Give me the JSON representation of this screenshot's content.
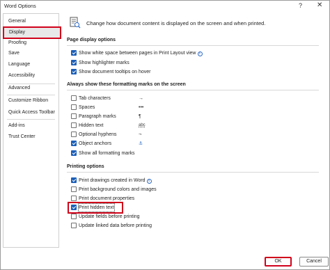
{
  "window": {
    "title": "Word Options",
    "help_glyph": "?",
    "close_glyph": "✕"
  },
  "sidebar": {
    "items": [
      {
        "label": "General"
      },
      {
        "label": "Display"
      },
      {
        "label": "Proofing"
      },
      {
        "label": "Save"
      },
      {
        "label": "Language"
      },
      {
        "label": "Accessibility"
      },
      {
        "label": "Advanced"
      },
      {
        "label": "Customize Ribbon"
      },
      {
        "label": "Quick Access Toolbar"
      },
      {
        "label": "Add-ins"
      },
      {
        "label": "Trust Center"
      }
    ],
    "selected": "Display"
  },
  "main": {
    "header_text": "Change how document content is displayed on the screen and when printed.",
    "page_display": {
      "title": "Page display options",
      "options": [
        {
          "label": "Show white space between pages in Print Layout view",
          "checked": true,
          "info": "i"
        },
        {
          "label": "Show highlighter marks",
          "checked": true
        },
        {
          "label": "Show document tooltips on hover",
          "checked": true
        }
      ]
    },
    "formatting_marks": {
      "title": "Always show these formatting marks on the screen",
      "options": [
        {
          "label": "Tab characters",
          "checked": false,
          "symbol": "→"
        },
        {
          "label": "Spaces",
          "checked": false,
          "symbol": "•••"
        },
        {
          "label": "Paragraph marks",
          "checked": false,
          "symbol": "¶"
        },
        {
          "label": "Hidden text",
          "checked": false,
          "symbol": "abc"
        },
        {
          "label": "Optional hyphens",
          "checked": false,
          "symbol": "¬"
        },
        {
          "label": "Object anchors",
          "checked": true,
          "symbol": "⚓"
        },
        {
          "label": "Show all formatting marks",
          "checked": false
        }
      ]
    },
    "printing": {
      "title": "Printing options",
      "options": [
        {
          "label": "Print drawings created in Word",
          "checked": true,
          "info": "i"
        },
        {
          "label": "Print background colors and images",
          "checked": false
        },
        {
          "label": "Print document properties",
          "checked": false
        },
        {
          "label": "Print hidden text",
          "checked": true
        },
        {
          "label": "Update fields before printing",
          "checked": false
        },
        {
          "label": "Update linked data before printing",
          "checked": false
        }
      ]
    }
  },
  "buttons": {
    "ok": "OK",
    "cancel": "Cancel"
  },
  "colors": {
    "highlight": "#d0021b",
    "checkbox_checked": "#1c5fb8"
  }
}
